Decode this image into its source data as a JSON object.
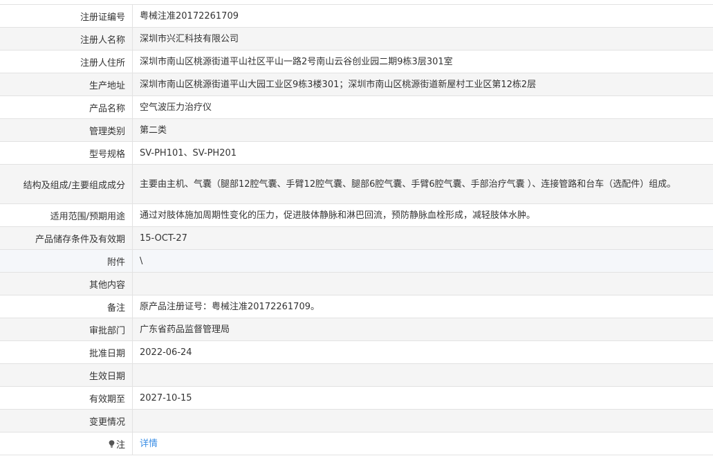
{
  "fields": [
    {
      "label": "注册证编号",
      "value": "粤械注准20172261709"
    },
    {
      "label": "注册人名称",
      "value": "深圳市兴汇科技有限公司"
    },
    {
      "label": "注册人住所",
      "value": "深圳市南山区桃源街道平山社区平山一路2号南山云谷创业园二期9栋3层301室"
    },
    {
      "label": "生产地址",
      "value": "深圳市南山区桃源街道平山大园工业区9栋3楼301；深圳市南山区桃源街道新屋村工业区第12栋2层"
    },
    {
      "label": "产品名称",
      "value": "空气波压力治疗仪"
    },
    {
      "label": "管理类别",
      "value": "第二类"
    },
    {
      "label": "型号规格",
      "value": "SV-PH101、SV-PH201"
    },
    {
      "label": "结构及组成/主要组成成分",
      "value": "主要由主机、气囊（腿部12腔气囊、手臂12腔气囊、腿部6腔气囊、手臂6腔气囊、手部治疗气囊 ）、连接管路和台车（选配件）组成。"
    },
    {
      "label": "适用范围/预期用途",
      "value": "通过对肢体施加周期性变化的压力，促进肢体静脉和淋巴回流，预防静脉血栓形成，减轻肢体水肿。"
    },
    {
      "label": "产品储存条件及有效期",
      "value": "15-OCT-27"
    },
    {
      "label": "附件",
      "value": "\\"
    },
    {
      "label": "其他内容",
      "value": ""
    },
    {
      "label": "备注",
      "value": "原产品注册证号：粤械注准20172261709。"
    },
    {
      "label": "审批部门",
      "value": "广东省药品监督管理局"
    },
    {
      "label": "批准日期",
      "value": "2022-06-24"
    },
    {
      "label": "生效日期",
      "value": ""
    },
    {
      "label": "有效期至",
      "value": "2027-10-15"
    },
    {
      "label": "变更情况",
      "value": ""
    }
  ],
  "note": {
    "label": "注",
    "icon": "lightbulb-icon",
    "link_text": "详情",
    "link_color": "#3a8ee6"
  }
}
